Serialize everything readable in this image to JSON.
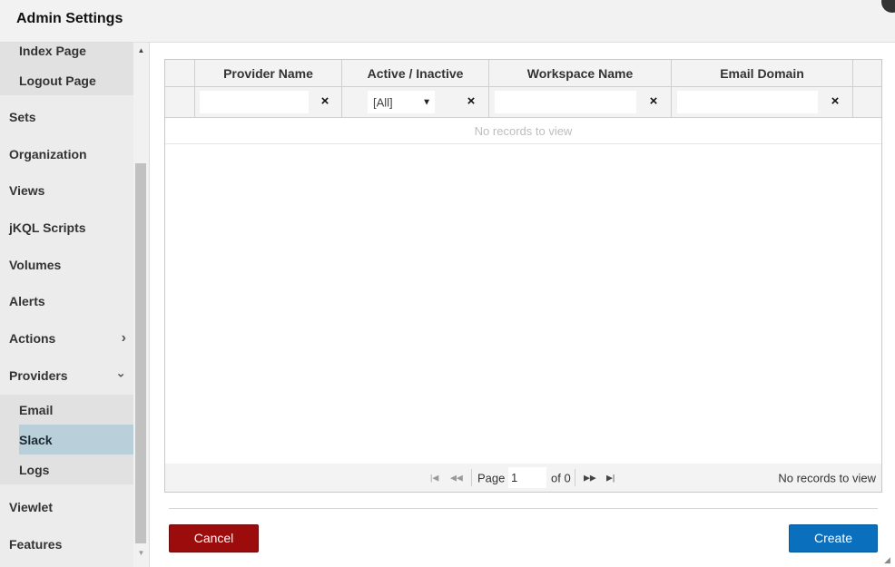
{
  "dialog": {
    "title": "Admin Settings"
  },
  "sidebar": {
    "items": [
      {
        "label": "Index Page",
        "level": "sub"
      },
      {
        "label": "Logout Page",
        "level": "sub"
      },
      {
        "label": "Sets",
        "level": "top"
      },
      {
        "label": "Organization",
        "level": "top"
      },
      {
        "label": "Views",
        "level": "top"
      },
      {
        "label": "jKQL Scripts",
        "level": "top"
      },
      {
        "label": "Volumes",
        "level": "top"
      },
      {
        "label": "Alerts",
        "level": "top"
      },
      {
        "label": "Actions",
        "level": "top",
        "chevron": "chevron-right-icon"
      },
      {
        "label": "Providers",
        "level": "top",
        "chevron": "chevron-down-icon"
      },
      {
        "label": "Email",
        "level": "sub"
      },
      {
        "label": "Slack",
        "level": "sub",
        "selected": true
      },
      {
        "label": "Logs",
        "level": "sub"
      },
      {
        "label": "Viewlet",
        "level": "top"
      },
      {
        "label": "Features",
        "level": "top"
      }
    ],
    "chevrons": {
      "right": "›",
      "down": "⌄"
    }
  },
  "grid": {
    "columns": [
      "Provider Name",
      "Active / Inactive",
      "Workspace Name",
      "Email Domain"
    ],
    "filters": {
      "provider_name": "",
      "active_select": "[All]",
      "workspace_name": "",
      "email_domain": ""
    },
    "clear_glyph": "×",
    "empty_message": "No records to view"
  },
  "pager": {
    "page_label": "Page",
    "page_value": "1",
    "of_label": "of 0",
    "records_text": "No records to view"
  },
  "footer": {
    "cancel_label": "Cancel",
    "create_label": "Create"
  },
  "colors": {
    "cancel": "#9c0c0c",
    "create": "#0a6fbd",
    "selected_item": "#b9cfd9"
  }
}
